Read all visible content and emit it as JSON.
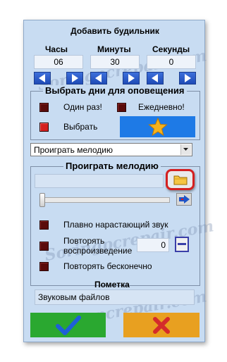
{
  "dialog": {
    "title": "Добавить будильник",
    "time": {
      "hours_label": "Часы",
      "minutes_label": "Минуты",
      "seconds_label": "Секунды",
      "hours_value": "06",
      "minutes_value": "30",
      "seconds_value": "0"
    },
    "days_group": {
      "title": "Выбрать дни для оповещения",
      "once_label": "Один раз!",
      "daily_label": "Ежедневно!",
      "choose_label": "Выбрать",
      "once_checked": false,
      "daily_checked": false,
      "choose_checked": true
    },
    "action_select": {
      "value": "Проиграть мелодию"
    },
    "melody_group": {
      "title": "Проиграть мелодию",
      "file_path": "",
      "volume_position": 0.0,
      "smooth_label": "Плавно нарастающий звук",
      "repeat_label_line1": "Повторять",
      "repeat_label_line2": "воспроизведение",
      "repeat_count": "0",
      "forever_label": "Повторять бесконечно"
    },
    "note": {
      "label": "Пометка",
      "value": "Звуковым файлов"
    },
    "watermark": "Soringpcrepair.com"
  },
  "colors": {
    "panel_bg": "#c8dcf2",
    "ok_button": "#2aa830",
    "cancel_button": "#e8a020",
    "highlight_ring": "#d42020"
  }
}
